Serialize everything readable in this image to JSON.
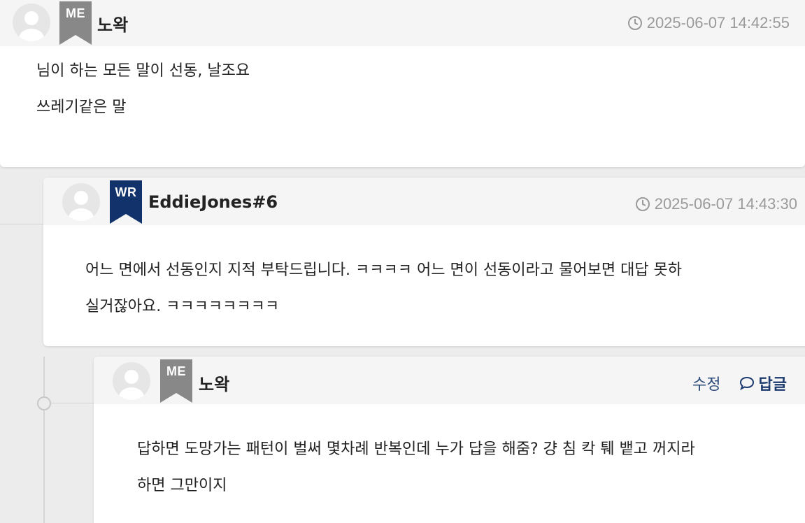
{
  "comments": [
    {
      "badge": "ME",
      "badge_color": "#888888",
      "username": "노왁",
      "timestamp": "2025-06-07 14:42:55",
      "lines": [
        "님이 하는 모든 말이 선동, 날조요",
        "쓰레기같은 말"
      ]
    },
    {
      "badge": "WR",
      "badge_color": "#12326b",
      "username": "EddieJones#6",
      "timestamp": "2025-06-07 14:43:30",
      "lines": [
        "어느 면에서 선동인지 지적 부탁드립니다. ㅋㅋㅋㅋ 어느 면이 선동이라고 물어보면 대답 못하",
        "실거잖아요. ㅋㅋㅋㅋㅋㅋㅋㅋ"
      ]
    },
    {
      "badge": "ME",
      "badge_color": "#888888",
      "username": "노왁",
      "edit_label": "수정",
      "reply_label": "답글",
      "lines": [
        "답하면 도망가는 패턴이 벌써 몇차례 반복인데 누가 답을 해줌? 걍 침 칵 퉤 뱉고 꺼지라",
        "하면 그만이지"
      ]
    }
  ],
  "icons": {
    "clock": "clock-icon",
    "avatar": "user-avatar-icon",
    "reply": "speech-bubble-icon"
  }
}
